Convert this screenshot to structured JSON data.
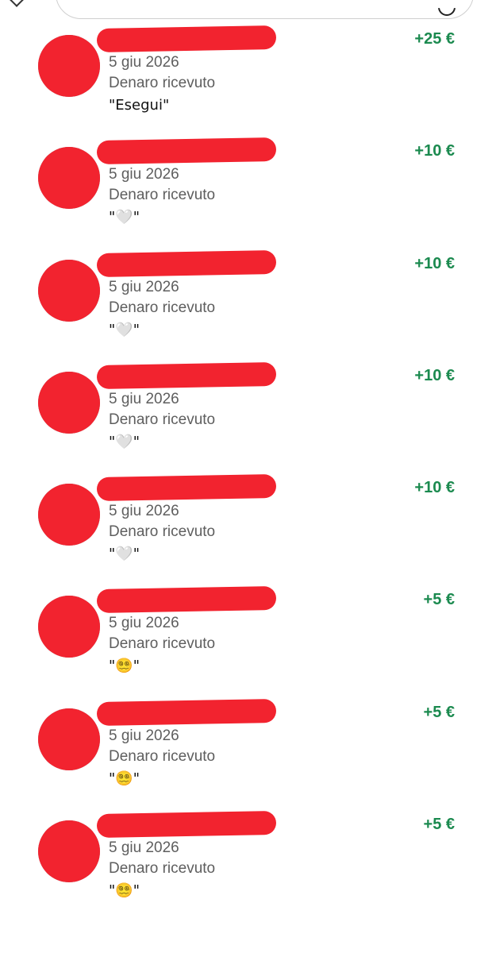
{
  "colors": {
    "accent_positive": "#1b8a4f",
    "text_secondary": "#5e5e5e",
    "redaction": "#f2232f"
  },
  "header": {
    "back_icon": "chevron-left-icon",
    "search_icon": "search-icon"
  },
  "transactions": [
    {
      "date": "5 giu 2026",
      "type": "Denaro ricevuto",
      "note": "\"Esegui\"",
      "amount": "+25 €"
    },
    {
      "date": "5 giu 2026",
      "type": "Denaro ricevuto",
      "note": "\"🤍\"",
      "amount": "+10 €"
    },
    {
      "date": "5 giu 2026",
      "type": "Denaro ricevuto",
      "note": "\"🤍\"",
      "amount": "+10 €"
    },
    {
      "date": "5 giu 2026",
      "type": "Denaro ricevuto",
      "note": "\"🤍\"",
      "amount": "+10 €"
    },
    {
      "date": "5 giu 2026",
      "type": "Denaro ricevuto",
      "note": "\"🤍\"",
      "amount": "+10 €"
    },
    {
      "date": "5 giu 2026",
      "type": "Denaro ricevuto",
      "note": "\"😵‍💫\"",
      "amount": "+5 €"
    },
    {
      "date": "5 giu 2026",
      "type": "Denaro ricevuto",
      "note": "\"😵‍💫\"",
      "amount": "+5 €"
    },
    {
      "date": "5 giu 2026",
      "type": "Denaro ricevuto",
      "note": "\"😵‍💫\"",
      "amount": "+5 €"
    }
  ]
}
